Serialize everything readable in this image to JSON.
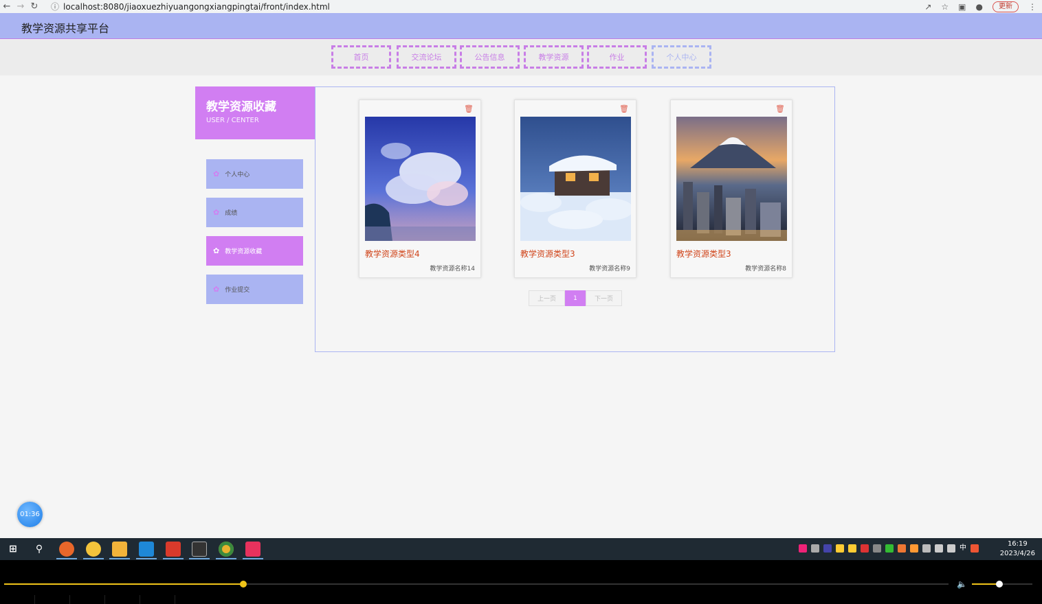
{
  "browser": {
    "url": "localhost:8080/jiaoxuezhiyuangongxiangpingtai/front/index.html",
    "update_label": "更新"
  },
  "site": {
    "title": "教学资源共享平台",
    "nav": [
      "首页",
      "交流论坛",
      "公告信息",
      "教学资源",
      "作业",
      "个人中心"
    ]
  },
  "sidebar": {
    "title": "教学资源收藏",
    "subtitle": "USER / CENTER",
    "items": [
      {
        "label": "个人中心",
        "active": false
      },
      {
        "label": "成绩",
        "active": false
      },
      {
        "label": "教学资源收藏",
        "active": true
      },
      {
        "label": "作业提交",
        "active": false
      }
    ]
  },
  "cards": [
    {
      "type": "教学资源类型4",
      "name": "教学资源名称14",
      "image": "sky-clouds"
    },
    {
      "type": "教学资源类型3",
      "name": "教学资源名称9",
      "image": "snow-house"
    },
    {
      "type": "教学资源类型3",
      "name": "教学资源名称8",
      "image": "mountain-city"
    }
  ],
  "pager": {
    "prev": "上一页",
    "page": "1",
    "next": "下一页"
  },
  "timer": "01:36",
  "taskbar": {
    "time": "16:19",
    "date": "2023/4/26",
    "lang": "中"
  },
  "video": {
    "progress": 0.253,
    "volume": 0.45
  },
  "colors": {
    "header": "#aab4f2",
    "accent": "#d17ef2",
    "card_title": "#d0451b"
  }
}
